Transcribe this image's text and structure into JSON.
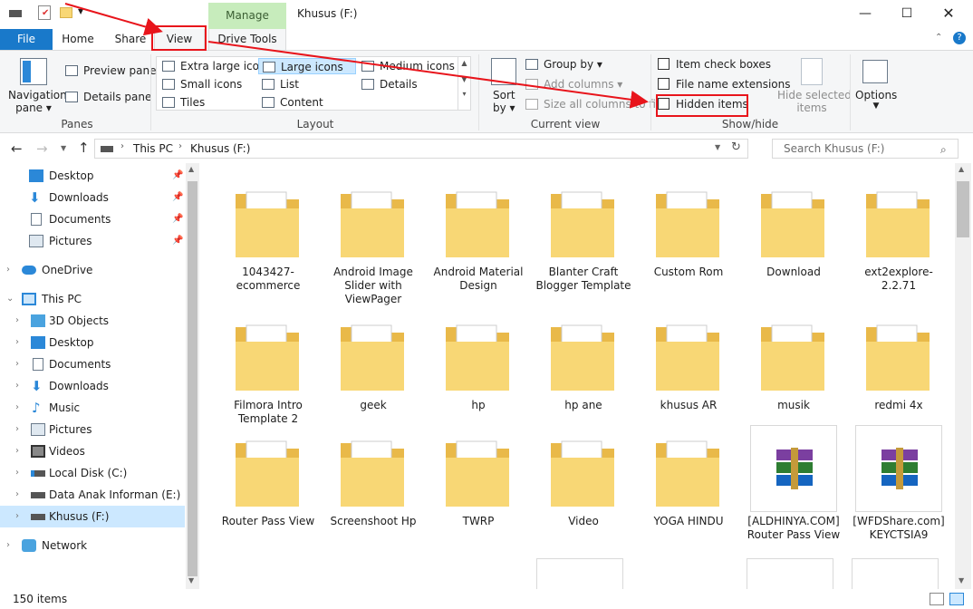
{
  "window": {
    "title": "Khusus (F:)",
    "manage_label": "Manage"
  },
  "tabs": {
    "file": "File",
    "home": "Home",
    "share": "Share",
    "view": "View",
    "drive_tools": "Drive Tools"
  },
  "ribbon": {
    "panes": {
      "navigation_pane": "Navigation",
      "navigation_pane_2": "pane",
      "preview_pane": "Preview pane",
      "details_pane": "Details pane",
      "group": "Panes"
    },
    "layout": {
      "extra_large_icons": "Extra large icons",
      "large_icons": "Large icons",
      "medium_icons": "Medium icons",
      "small_icons": "Small icons",
      "list": "List",
      "details": "Details",
      "tiles": "Tiles",
      "content": "Content",
      "group": "Layout",
      "selected": "Large icons"
    },
    "current_view": {
      "sort_by": "Sort",
      "sort_by_2": "by",
      "group_by": "Group by",
      "add_columns": "Add columns",
      "size_all_columns": "Size all columns to fit",
      "group": "Current view"
    },
    "show_hide": {
      "item_check_boxes": "Item check boxes",
      "file_name_extensions": "File name extensions",
      "hidden_items": "Hidden items",
      "hide_selected_items": "Hide selected",
      "hide_selected_items_2": "items",
      "group": "Show/hide"
    },
    "options": "Options"
  },
  "address": {
    "path": [
      "This PC",
      "Khusus (F:)"
    ],
    "search_placeholder": "Search Khusus (F:)"
  },
  "nav": {
    "quick_access": [
      {
        "label": "Desktop",
        "icon": "desktop-icon"
      },
      {
        "label": "Downloads",
        "icon": "downloads-icon"
      },
      {
        "label": "Documents",
        "icon": "documents-icon"
      },
      {
        "label": "Pictures",
        "icon": "pictures-icon"
      }
    ],
    "onedrive": "OneDrive",
    "this_pc": "This PC",
    "this_pc_items": [
      {
        "label": "3D Objects",
        "icon": "3d-objects-icon"
      },
      {
        "label": "Desktop",
        "icon": "desktop-icon"
      },
      {
        "label": "Documents",
        "icon": "documents-icon"
      },
      {
        "label": "Downloads",
        "icon": "downloads-icon"
      },
      {
        "label": "Music",
        "icon": "music-icon"
      },
      {
        "label": "Pictures",
        "icon": "pictures-icon"
      },
      {
        "label": "Videos",
        "icon": "videos-icon"
      },
      {
        "label": "Local Disk (C:)",
        "icon": "local-disk-icon"
      },
      {
        "label": "Data Anak Informan (E:)",
        "icon": "drive-icon"
      },
      {
        "label": "Khusus (F:)",
        "icon": "drive-icon",
        "selected": true
      }
    ],
    "network": "Network"
  },
  "items": [
    {
      "label": "1043427-ecommerce",
      "kind": "folder"
    },
    {
      "label": "Android Image Slider with ViewPager",
      "kind": "folder"
    },
    {
      "label": "Android Material Design",
      "kind": "folder"
    },
    {
      "label": "Blanter Craft Blogger Template",
      "kind": "folder"
    },
    {
      "label": "Custom Rom",
      "kind": "folder"
    },
    {
      "label": "Download",
      "kind": "folder"
    },
    {
      "label": "ext2explore-2.2.71",
      "kind": "folder"
    },
    {
      "label": "Filmora Intro Template 2",
      "kind": "folder"
    },
    {
      "label": "geek",
      "kind": "folder"
    },
    {
      "label": "hp",
      "kind": "folder"
    },
    {
      "label": "hp ane",
      "kind": "folder"
    },
    {
      "label": "khusus AR",
      "kind": "folder"
    },
    {
      "label": "musik",
      "kind": "folder"
    },
    {
      "label": "redmi 4x",
      "kind": "folder"
    },
    {
      "label": "Router Pass View",
      "kind": "folder"
    },
    {
      "label": "Screenshoot Hp",
      "kind": "folder"
    },
    {
      "label": "TWRP",
      "kind": "folder"
    },
    {
      "label": "Video",
      "kind": "folder"
    },
    {
      "label": "YOGA HINDU",
      "kind": "folder"
    },
    {
      "label": "[ALDHINYA.COM] Router Pass View",
      "kind": "archive"
    },
    {
      "label": "[WFDShare.com] KEYCTSIA9",
      "kind": "archive"
    }
  ],
  "status": {
    "count": "150 items"
  },
  "colors": {
    "accent": "#1979ca",
    "manage_tab": "#c7ecbc",
    "selection": "#cce8ff",
    "annotation": "#e8141b",
    "folder": "#f8d775"
  }
}
